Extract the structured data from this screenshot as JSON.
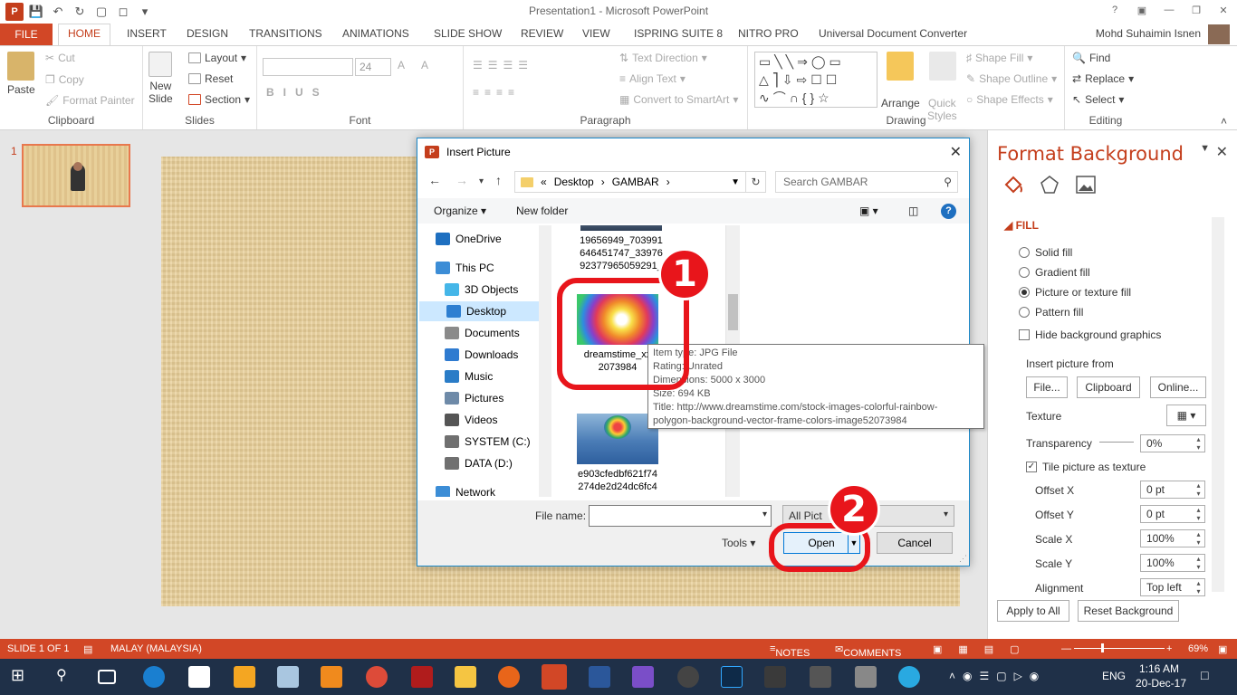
{
  "window": {
    "title": "Presentation1 - Microsoft PowerPoint"
  },
  "ribbon_tabs": [
    "FILE",
    "HOME",
    "INSERT",
    "DESIGN",
    "TRANSITIONS",
    "ANIMATIONS",
    "SLIDE SHOW",
    "REVIEW",
    "VIEW",
    "ISPRING SUITE 8",
    "NITRO PRO",
    "Universal Document Converter"
  ],
  "user_name": "Mohd Suhaimin Isnen",
  "ribbon": {
    "clipboard": {
      "paste": "Paste",
      "cut": "Cut",
      "copy": "Copy",
      "format_painter": "Format Painter",
      "label": "Clipboard"
    },
    "slides": {
      "new_slide_1": "New",
      "new_slide_2": "Slide",
      "layout": "Layout",
      "reset": "Reset",
      "section": "Section",
      "label": "Slides"
    },
    "font": {
      "size": "24",
      "label": "Font"
    },
    "paragraph": {
      "text_direction": "Text Direction",
      "align_text": "Align Text",
      "convert_smartart": "Convert to SmartArt",
      "label": "Paragraph"
    },
    "drawing": {
      "arrange": "Arrange",
      "quick_styles_1": "Quick",
      "quick_styles_2": "Styles",
      "shape_fill": "Shape Fill",
      "shape_outline": "Shape Outline",
      "shape_effects": "Shape Effects",
      "label": "Drawing"
    },
    "editing": {
      "find": "Find",
      "replace": "Replace",
      "select": "Select",
      "label": "Editing"
    }
  },
  "thumbnail": {
    "number": "1"
  },
  "dialog": {
    "title": "Insert Picture",
    "breadcrumb_prefix": "«",
    "breadcrumb_1": "Desktop",
    "breadcrumb_2": "GAMBAR",
    "search_placeholder": "Search GAMBAR",
    "organize": "Organize",
    "new_folder": "New folder",
    "nav_items": [
      {
        "label": "OneDrive",
        "color": "#1e6fc0"
      },
      {
        "label": "This PC",
        "color": "#3c8dd6"
      },
      {
        "label": "3D Objects",
        "color": "#45b6e8"
      },
      {
        "label": "Desktop",
        "color": "#2e7fd1"
      },
      {
        "label": "Documents",
        "color": "#8a8a8a"
      },
      {
        "label": "Downloads",
        "color": "#2f7bd0"
      },
      {
        "label": "Music",
        "color": "#2a7cc7"
      },
      {
        "label": "Pictures",
        "color": "#6e8aa8"
      },
      {
        "label": "Videos",
        "color": "#555555"
      },
      {
        "label": "SYSTEM (C:)",
        "color": "#707070"
      },
      {
        "label": "DATA (D:)",
        "color": "#707070"
      },
      {
        "label": "Network",
        "color": "#3c8dd6"
      }
    ],
    "files": [
      {
        "line1": "19656949_703991",
        "line2": "646451747_33976",
        "line3": "92377965059291_"
      },
      {
        "line1": "dreamstime_xx",
        "line2": "2073984",
        "line3": ""
      },
      {
        "line1": "e903cfedbf621f74",
        "line2": "274de2d24dc6fc4",
        "line3": ""
      }
    ],
    "tooltip": {
      "type": "Item type: JPG File",
      "rating": "Rating: Unrated",
      "dimensions": "Dimensions: 5000 x 3000",
      "size": "Size: 694 KB",
      "title_line1": "Title: http://www.dreamstime.com/stock-images-colorful-rainbow-",
      "title_line2": "polygon-background-vector-frame-colors-image52073984"
    },
    "file_name_label": "File name:",
    "file_name_value": "",
    "filter_value": "All Pict",
    "tools": "Tools",
    "open": "Open",
    "cancel": "Cancel"
  },
  "annotations": {
    "step1": "1",
    "step2": "2",
    "color": "#e8151b"
  },
  "format_pane": {
    "title": "Format Background",
    "section": "FILL",
    "options": [
      "Solid fill",
      "Gradient fill",
      "Picture or texture fill",
      "Pattern fill"
    ],
    "selected_option": "Picture or texture fill",
    "hide_bg": "Hide background graphics",
    "insert_from": "Insert picture from",
    "file_btn": "File...",
    "clipboard_btn": "Clipboard",
    "online_btn": "Online...",
    "texture": "Texture",
    "transparency": "Transparency",
    "transparency_value": "0%",
    "tile": "Tile picture as texture",
    "offset_x": "Offset X",
    "offset_x_value": "0 pt",
    "offset_y": "Offset Y",
    "offset_y_value": "0 pt",
    "scale_x": "Scale X",
    "scale_x_value": "100%",
    "scale_y": "Scale Y",
    "scale_y_value": "100%",
    "alignment": "Alignment",
    "alignment_value": "Top left",
    "apply_all": "Apply to All",
    "reset_bg": "Reset Background"
  },
  "statusbar": {
    "slide": "SLIDE 1 OF 1",
    "language": "MALAY (MALAYSIA)",
    "notes": "NOTES",
    "comments": "COMMENTS",
    "zoom": "69%"
  },
  "taskbar": {
    "time": "1:16 AM",
    "date": "20-Dec-17",
    "lang": "ENG"
  },
  "accent_color": "#d24726"
}
